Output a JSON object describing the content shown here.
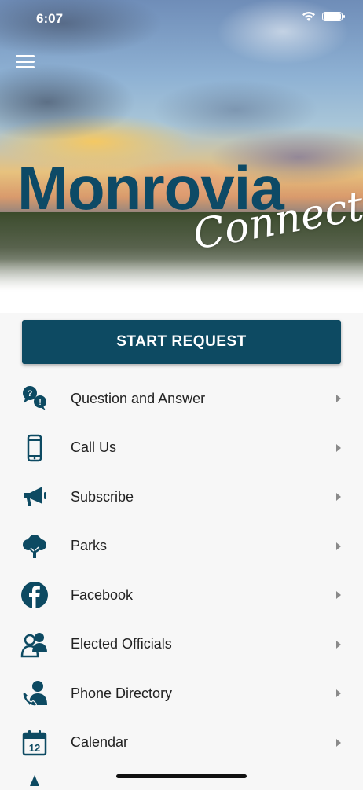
{
  "status_bar": {
    "time": "6:07"
  },
  "hero": {
    "logo_main": "Monrovia",
    "logo_script": "Connect"
  },
  "start_button_label": "START REQUEST",
  "menu": [
    {
      "label": "Question and Answer",
      "icon": "question-answer-icon"
    },
    {
      "label": "Call Us",
      "icon": "phone-icon"
    },
    {
      "label": "Subscribe",
      "icon": "megaphone-icon"
    },
    {
      "label": "Parks",
      "icon": "tree-icon"
    },
    {
      "label": "Facebook",
      "icon": "facebook-icon"
    },
    {
      "label": "Elected Officials",
      "icon": "officials-icon"
    },
    {
      "label": "Phone Directory",
      "icon": "phone-directory-icon"
    },
    {
      "label": "Calendar",
      "icon": "calendar-icon"
    }
  ],
  "colors": {
    "brand": "#0d4a62",
    "icon": "#0d4a62",
    "chevron": "#8a8a8a",
    "background": "#f7f7f7"
  }
}
